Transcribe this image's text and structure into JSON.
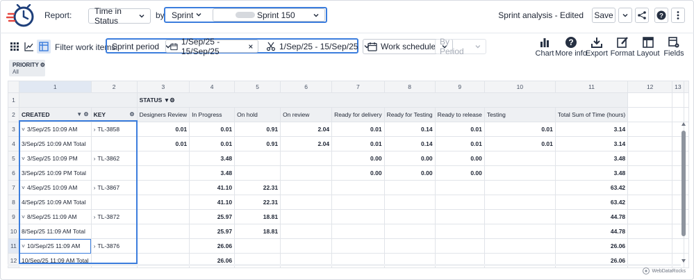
{
  "header": {
    "report_label": "Report:",
    "report_value": "Time in Status",
    "by_label": "by",
    "by_value": "Sprint",
    "sprint_value": "Sprint 150",
    "title": "Sprint analysis - Edited",
    "save_label": "Save"
  },
  "toolbar": {
    "filter_label": "Filter work items:",
    "period_mode": "Sprint period",
    "date_range_1": "1/Sep/25 - 15/Sep/25",
    "date_range_2": "1/Sep/25 - 15/Sep/25",
    "work_schedule": "Work schedule",
    "by_period": "By Period",
    "tools": [
      {
        "label": "Chart",
        "icon": "bar-chart-icon"
      },
      {
        "label": "More info",
        "icon": "help-icon"
      },
      {
        "label": "Export",
        "icon": "export-icon"
      },
      {
        "label": "Format",
        "icon": "format-icon"
      },
      {
        "label": "Layout",
        "icon": "layout-icon"
      },
      {
        "label": "Fields",
        "icon": "fields-icon"
      }
    ]
  },
  "filter_chip": {
    "title": "PRIORITY",
    "value": "All"
  },
  "grid": {
    "col_numbers": [
      "1",
      "2",
      "3",
      "4",
      "5",
      "6",
      "7",
      "8",
      "9",
      "10",
      "11",
      "12",
      "13"
    ],
    "status_label": "STATUS",
    "created_label": "CREATED",
    "key_label": "KEY",
    "status_columns": [
      "Designers Review",
      "In Progress",
      "On hold",
      "On review",
      "Ready for delivery",
      "Ready for Testing",
      "Ready to release",
      "Testing",
      "Total Sum of Time (hours)"
    ],
    "rows": [
      {
        "num": "3",
        "created": "3/Sep/25 10:09 AM",
        "expand": true,
        "key": "TL-3858",
        "values": [
          "0.01",
          "0.01",
          "0.91",
          "2.04",
          "0.01",
          "0.14",
          "0.01",
          "0.01",
          "3.14"
        ]
      },
      {
        "num": "4",
        "created": "3/Sep/25 10:09 AM Total",
        "expand": false,
        "key": "",
        "values": [
          "0.01",
          "0.01",
          "0.91",
          "2.04",
          "0.01",
          "0.14",
          "0.01",
          "0.01",
          "3.14"
        ]
      },
      {
        "num": "5",
        "created": "3/Sep/25 10:09 PM",
        "expand": true,
        "key": "TL-3862",
        "values": [
          "",
          "3.48",
          "",
          "",
          "0.00",
          "0.00",
          "0.00",
          "",
          "3.48"
        ]
      },
      {
        "num": "6",
        "created": "3/Sep/25 10:09 PM Total",
        "expand": false,
        "key": "",
        "values": [
          "",
          "3.48",
          "",
          "",
          "0.00",
          "0.00",
          "0.00",
          "",
          "3.48"
        ]
      },
      {
        "num": "7",
        "created": "4/Sep/25 10:09 AM",
        "expand": true,
        "key": "TL-3867",
        "values": [
          "",
          "41.10",
          "22.31",
          "",
          "",
          "",
          "",
          "",
          "63.42"
        ]
      },
      {
        "num": "8",
        "created": "4/Sep/25 10:09 AM Total",
        "expand": false,
        "key": "",
        "values": [
          "",
          "41.10",
          "22.31",
          "",
          "",
          "",
          "",
          "",
          "63.42"
        ]
      },
      {
        "num": "9",
        "created": "8/Sep/25 11:09 AM",
        "expand": true,
        "key": "TL-3872",
        "values": [
          "",
          "25.97",
          "18.81",
          "",
          "",
          "",
          "",
          "",
          "44.78"
        ]
      },
      {
        "num": "10",
        "created": "8/Sep/25 11:09 AM Total",
        "expand": false,
        "key": "",
        "values": [
          "",
          "25.97",
          "18.81",
          "",
          "",
          "",
          "",
          "",
          "44.78"
        ]
      },
      {
        "num": "11",
        "created": "10/Sep/25 11:09 AM",
        "expand": true,
        "key": "TL-3876",
        "values": [
          "",
          "26.06",
          "",
          "",
          "",
          "",
          "",
          "",
          "26.06"
        ]
      },
      {
        "num": "12",
        "created": "10/Sep/25 11:09 AM Total",
        "expand": false,
        "key": "",
        "values": [
          "",
          "26.06",
          "",
          "",
          "",
          "",
          "",
          "",
          "26.06"
        ]
      }
    ]
  },
  "watermark": "WebDataRocks",
  "colors": {
    "accent": "#3b7ddd",
    "header_shade": "#eef0f3",
    "text": "#1d2433"
  }
}
